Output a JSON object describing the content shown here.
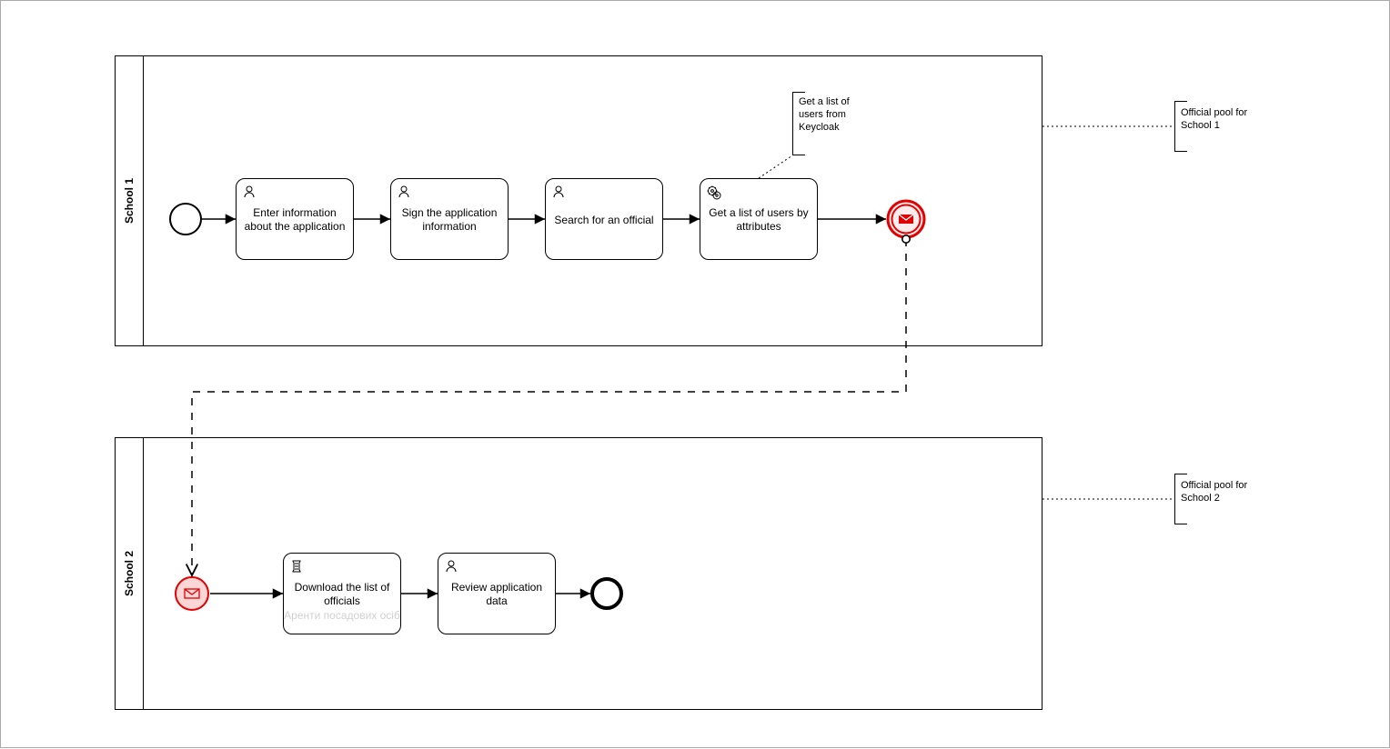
{
  "pools": {
    "school1": {
      "label": "School 1"
    },
    "school2": {
      "label": "School 2"
    }
  },
  "tasks": {
    "enter_info": "Enter information about the application",
    "sign_info": "Sign the application information",
    "search_official": "Search for an official",
    "get_users": "Get a list of users by attributes",
    "download_list": "Download the list of officials",
    "download_list_watermark": "Аренти\nпосадових осіб",
    "review_app": "Review application data"
  },
  "annotations": {
    "keycloak": "Get a list of users from Keycloak",
    "official_pool_1": "Official pool for School 1",
    "official_pool_2": "Official pool for School 2"
  }
}
